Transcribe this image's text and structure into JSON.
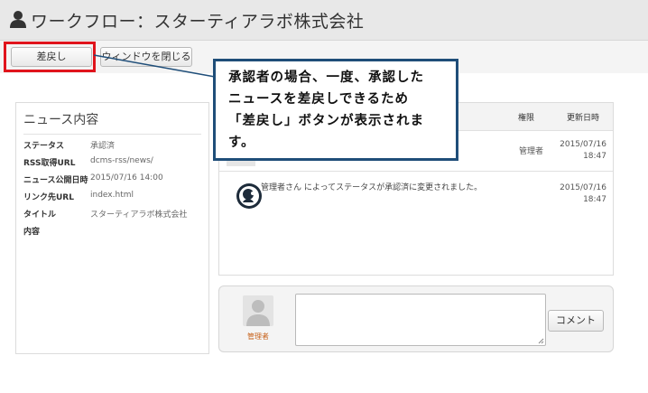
{
  "window": {
    "title": "ワークフロー：スターティアラボ株式会社"
  },
  "toolbar": {
    "return_label": "差戻し",
    "close_window_label": "ウィンドウを閉じる"
  },
  "callout": {
    "lines": [
      "承認者の場合、一度、承認した",
      "ニュースを差戻しできるため",
      "「差戻し」ボタンが表示されま",
      "す。"
    ]
  },
  "news": {
    "heading": "ニュース内容",
    "fields": [
      {
        "key": "ステータス",
        "value": "承認済"
      },
      {
        "key": "RSS取得URL",
        "value": "dcms-rss/news/"
      },
      {
        "key": "ニュース公開日時",
        "value": "2015/07/16 14:00"
      },
      {
        "key": "リンク先URL",
        "value": "index.html"
      },
      {
        "key": "タイトル",
        "value": "スターティアラボ株式会社"
      },
      {
        "key": "内容",
        "value": ""
      }
    ]
  },
  "history": {
    "columns": {
      "role": "権限",
      "updated": "更新日時"
    },
    "entries": [
      {
        "message": "",
        "role": "管理者",
        "date": "2015/07/16",
        "time": "18:47"
      },
      {
        "message": "管理者さん によってステータスが承認済に変更されました。",
        "role": "",
        "date": "2015/07/16",
        "time": "18:47"
      }
    ]
  },
  "comment": {
    "user_label": "管理者",
    "textarea_value": "",
    "submit_label": "コメント"
  },
  "icons": {
    "user": "user-icon",
    "avatar": "avatar-icon",
    "system": "system-icon"
  },
  "colors": {
    "highlight": "#e0141c",
    "callout_border": "#1f4e79",
    "user_label": "#c8641e"
  }
}
